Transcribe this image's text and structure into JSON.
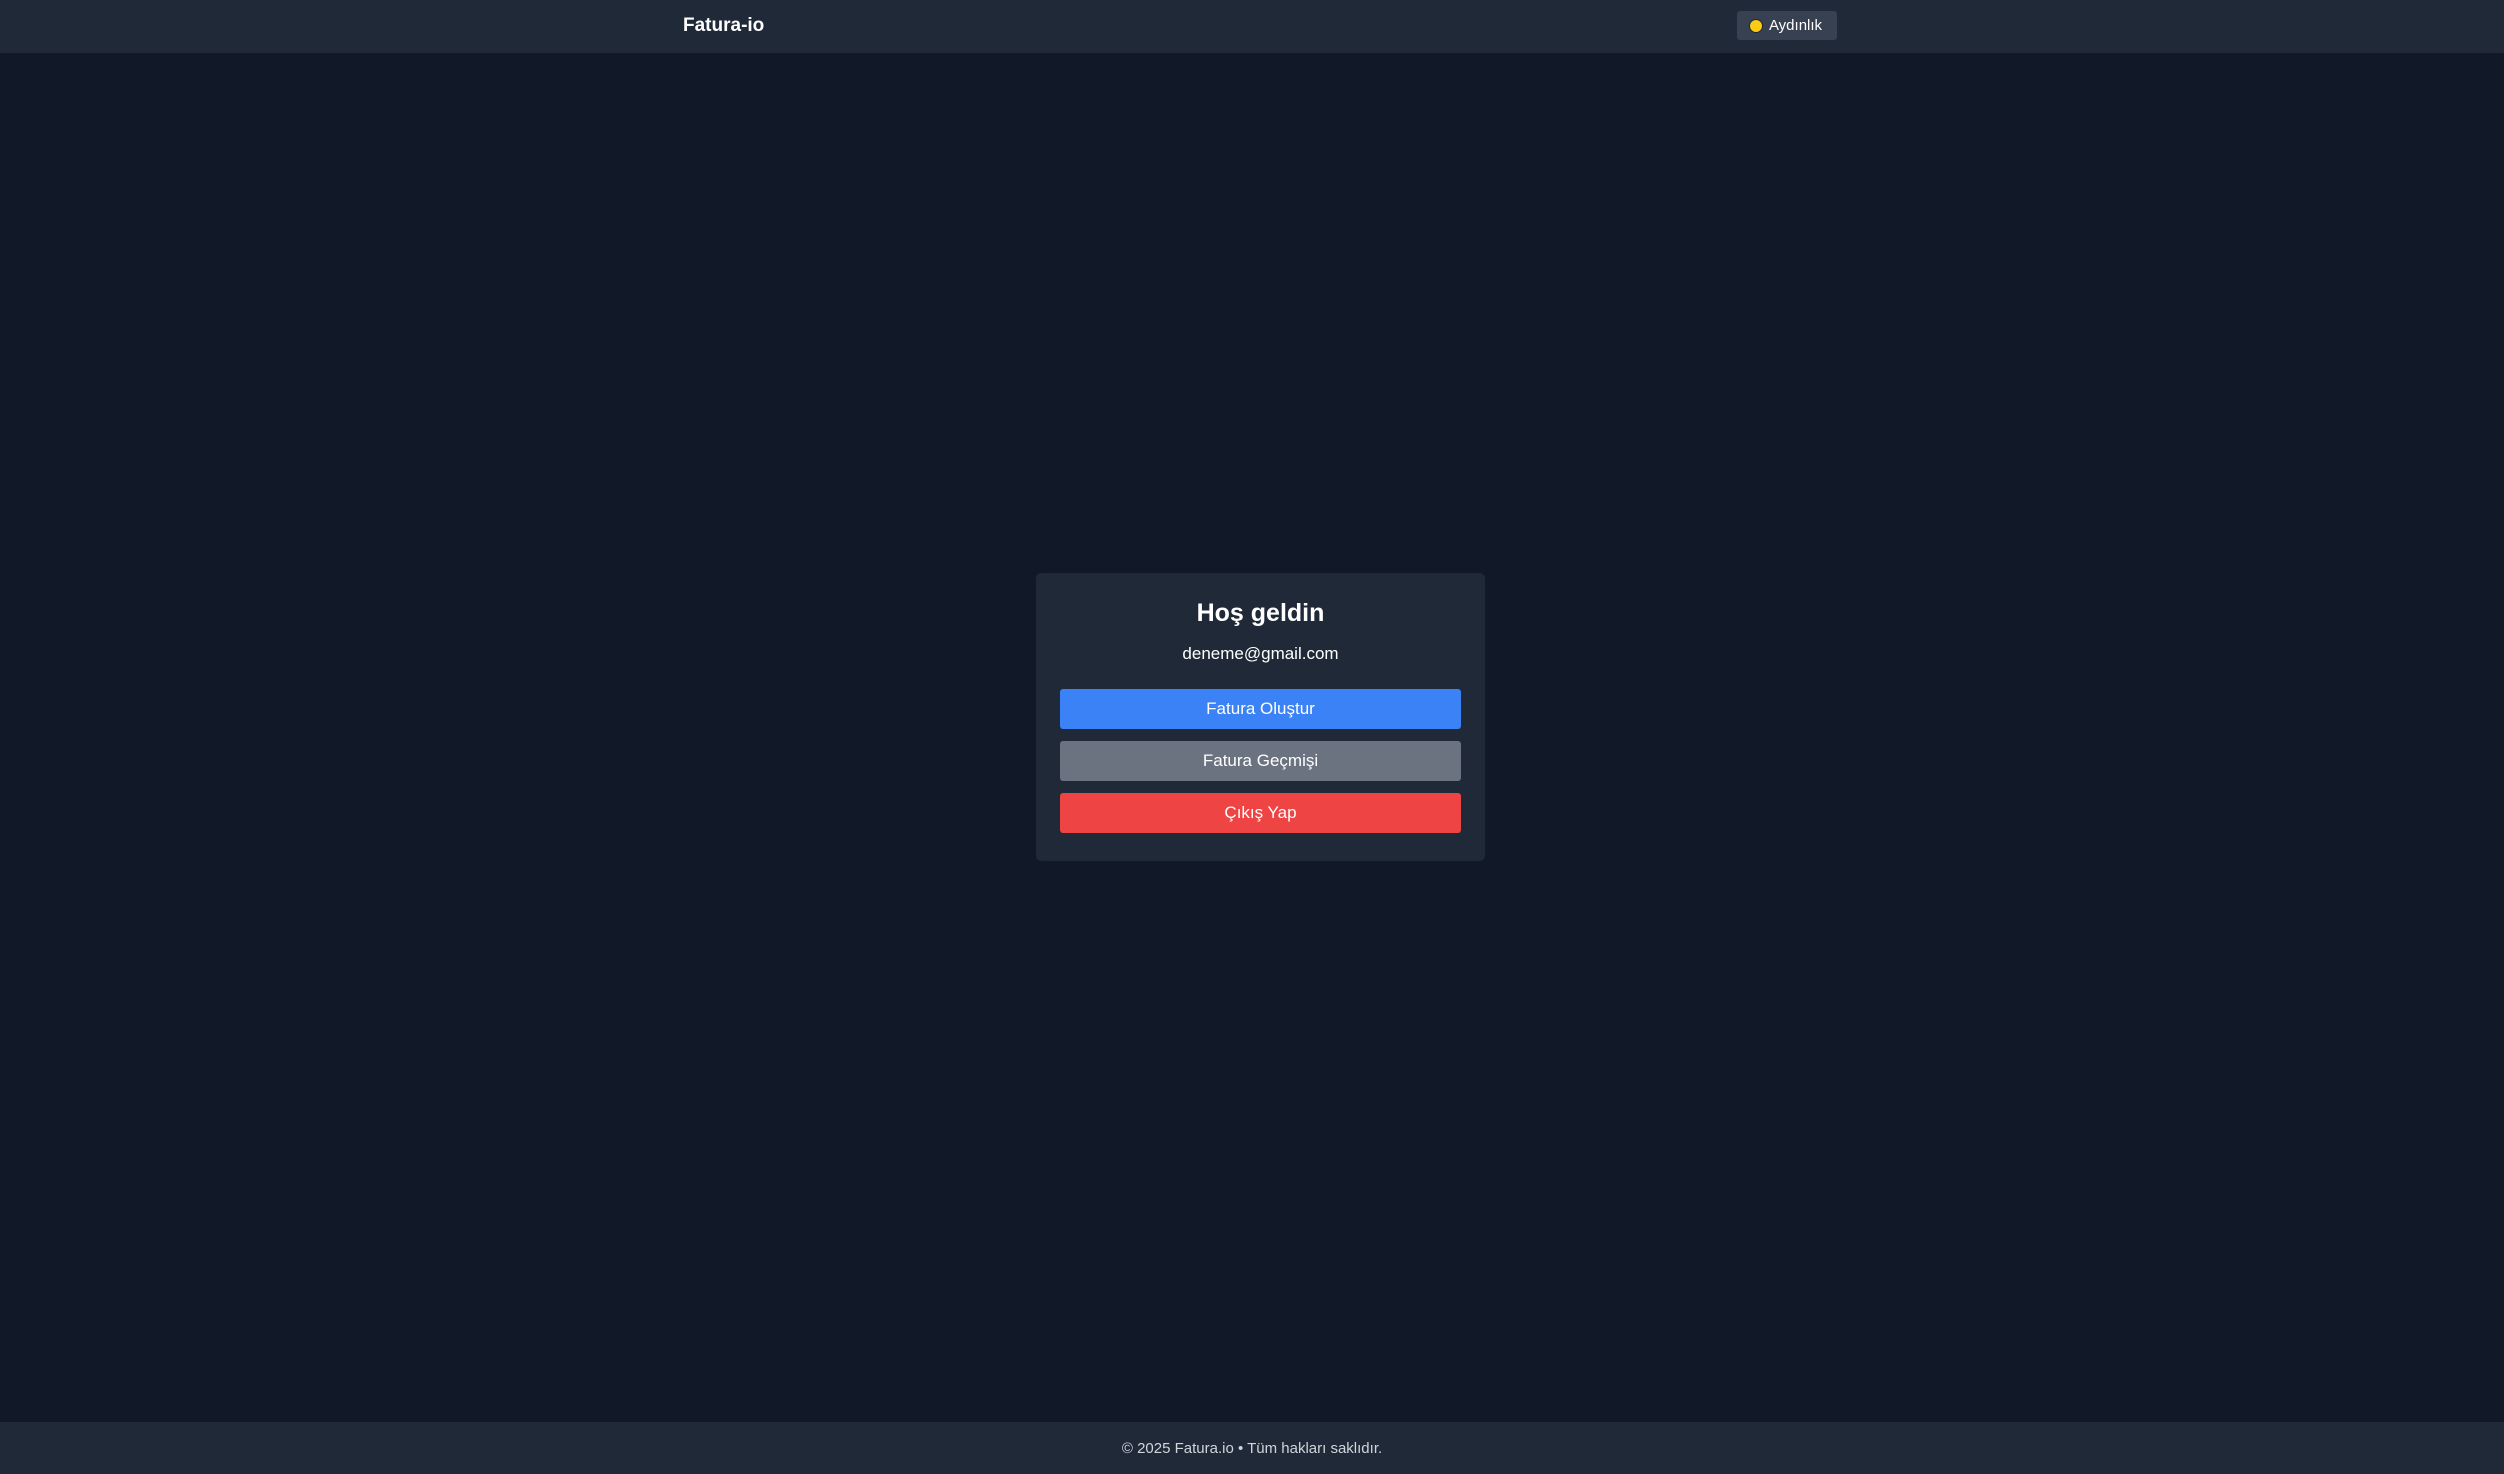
{
  "header": {
    "brand": "Fatura-io",
    "theme_toggle": {
      "icon": "sun-icon",
      "label": "Aydınlık"
    }
  },
  "card": {
    "title": "Hoş geldin",
    "email": "deneme@gmail.com",
    "buttons": {
      "create_invoice": "Fatura Oluştur",
      "invoice_history": "Fatura Geçmişi",
      "logout": "Çıkış Yap"
    }
  },
  "footer": {
    "text": "© 2025 Fatura.io • Tüm hakları saklıdır."
  },
  "colors": {
    "background": "#111827",
    "surface": "#1f2937",
    "primary": "#3b82f6",
    "secondary": "#6b7280",
    "danger": "#ef4444",
    "sun": "#facc15"
  }
}
